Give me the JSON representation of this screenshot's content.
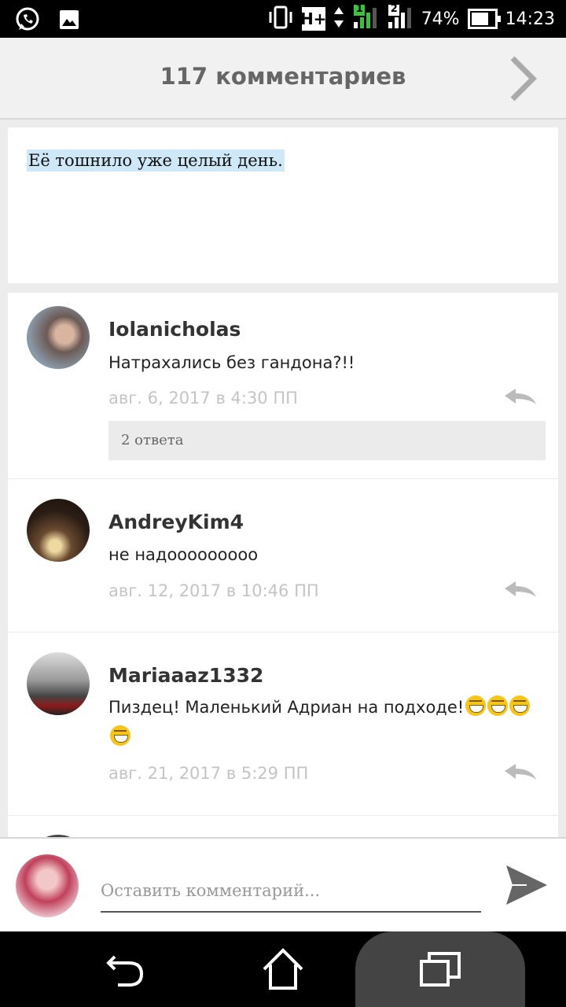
{
  "status_bar": {
    "network": "H+",
    "sim1": "1",
    "sim2": "2",
    "battery": "74%",
    "battery_level": 0.74,
    "time": "14:23",
    "icons": [
      "whatsapp-icon",
      "image-icon",
      "vibrate-icon",
      "data-arrows-icon",
      "signal-icon",
      "battery-icon"
    ]
  },
  "header": {
    "title": "117 комментариев",
    "next_icon": "chevron-right-icon"
  },
  "post": {
    "text": "Её тошнило уже целый день."
  },
  "comments": [
    {
      "user": "Iolanicholas",
      "text": "Натрахались без гандона?!!",
      "date": "авг. 6, 2017 в 4:30 ПП",
      "replies": "2 ответа"
    },
    {
      "user": "AndreyKim4",
      "text": "не надооооооооо",
      "date": "авг. 12, 2017 в 10:46 ПП"
    },
    {
      "user": "Mariaaaz1332",
      "text": "Пиздец! Маленький Адриан на подходе!",
      "emoji": "grinning-face-emoji",
      "date": "авг. 21, 2017 в 5:29 ПП"
    }
  ],
  "compose": {
    "placeholder": "Оставить комментарий...",
    "value": "",
    "send_icon": "send-icon"
  },
  "nav": {
    "icons": [
      "back-icon",
      "home-icon",
      "recents-icon"
    ]
  },
  "colors": {
    "header_bg": "#f1f1f1",
    "highlight": "#cfe8f7",
    "date_gray": "#c4c4c4"
  }
}
